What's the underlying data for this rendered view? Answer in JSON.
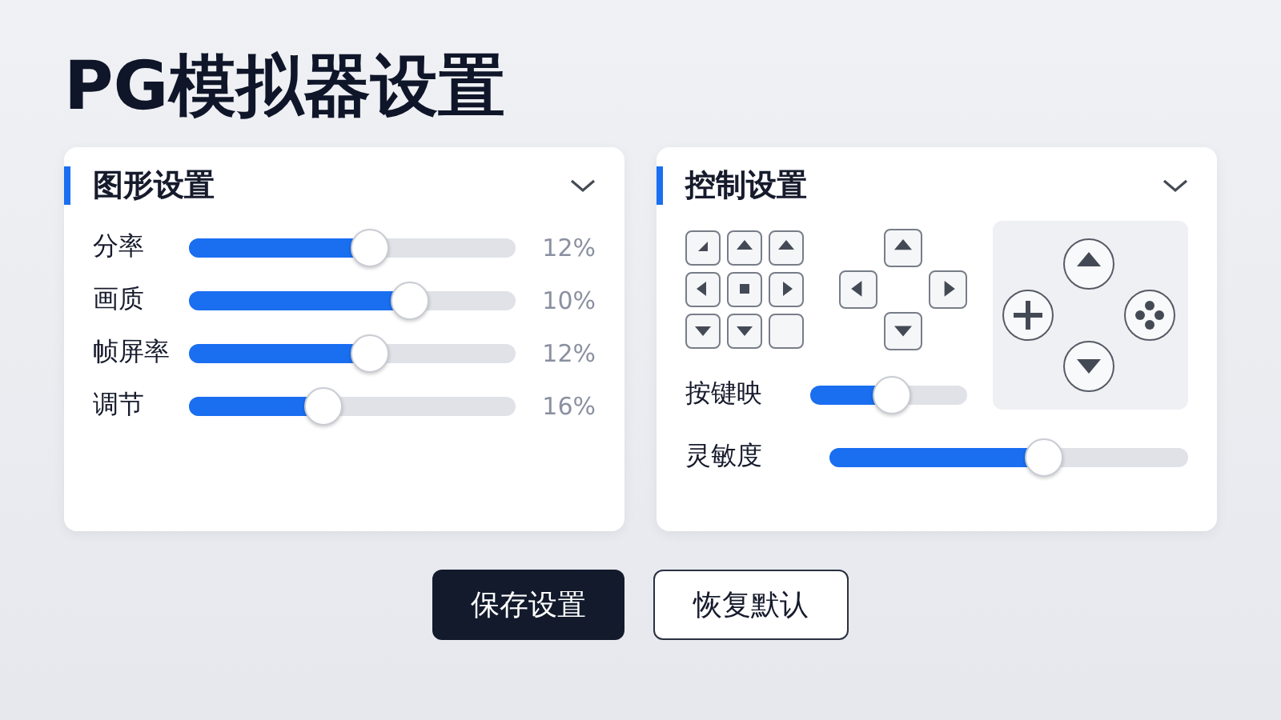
{
  "title": "PG模拟器设置",
  "graphics": {
    "title": "图形设置",
    "expanded": true,
    "sliders": [
      {
        "label": "分率",
        "level": 0.56,
        "reading": "12%"
      },
      {
        "label": "画质",
        "level": 0.7,
        "reading": "10%"
      },
      {
        "label": "帧屏率",
        "level": 0.56,
        "reading": "12%"
      },
      {
        "label": "调节",
        "level": 0.4,
        "reading": "16%"
      }
    ]
  },
  "controls": {
    "title": "控制设置",
    "expanded": true,
    "key_grid": [
      {
        "kind": "corner"
      },
      {
        "kind": "up"
      },
      {
        "kind": "up"
      },
      {
        "kind": "left"
      },
      {
        "kind": "stop"
      },
      {
        "kind": "right"
      },
      {
        "kind": "down"
      },
      {
        "kind": "down"
      },
      {
        "kind": "blank"
      }
    ],
    "dpad": [
      {
        "kind": "up"
      },
      {
        "kind": "left"
      },
      {
        "kind": "right"
      },
      {
        "kind": "down"
      }
    ],
    "gamepad": [
      {
        "kind": "up"
      },
      {
        "kind": "plus"
      },
      {
        "kind": "dots"
      },
      {
        "kind": "down"
      }
    ],
    "sliders": [
      {
        "label": "按键映",
        "level": 0.53
      },
      {
        "label": "灵敏度",
        "level": 0.61
      }
    ]
  },
  "buttons": [
    {
      "label": "保存设置",
      "kind": "primary"
    },
    {
      "label": "恢复默认",
      "kind": "secondary"
    }
  ]
}
